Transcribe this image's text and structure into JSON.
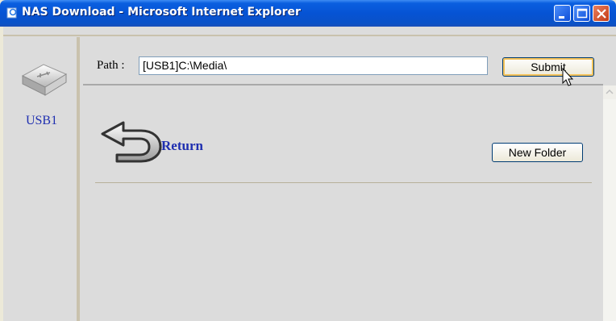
{
  "window": {
    "title": "NAS Download - Microsoft Internet Explorer",
    "icons": [
      "ie-page-icon",
      "minimize-icon",
      "maximize-icon",
      "close-icon"
    ]
  },
  "sidebar": {
    "device_icon": "usb-drive-icon",
    "device_label": "USB1"
  },
  "pathbar": {
    "label": "Path :",
    "value": "[USB1]C:\\Media\\",
    "submit_label": "Submit"
  },
  "content": {
    "return_icon": "return-arrow-icon",
    "return_label": "Return",
    "new_folder_label": "New Folder"
  },
  "colors": {
    "titlebar": "#0653d4",
    "link": "#1f2fb0",
    "panel": "#dcdcdc",
    "frame": "#c9c2ad"
  }
}
